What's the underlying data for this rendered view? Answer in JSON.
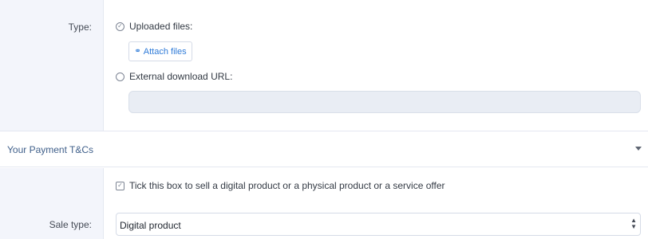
{
  "type_field": {
    "label": "Type:",
    "options": [
      {
        "label": "Uploaded files:",
        "icon": "check-circle-icon",
        "checked": true
      },
      {
        "label": "External download URL:",
        "icon": "radio-empty-icon",
        "checked": false
      }
    ],
    "attach_button": {
      "label": "Attach files",
      "icon": "paperclip-icon"
    },
    "url_input": {
      "value": "",
      "placeholder": ""
    }
  },
  "payment_section": {
    "title": "Your Payment T&Cs",
    "toggle_icon": "caret-down-icon"
  },
  "sale_field": {
    "checkbox_label": "Tick this box to sell a digital product or a physical product or a service offer",
    "checkbox_checked": true,
    "label": "Sale type:",
    "selected": "Digital product",
    "select_icon": "select-arrows-icon"
  },
  "colors": {
    "label_column_bg": "#f3f5fb",
    "link_blue": "#2f7bd8",
    "section_title": "#3f5f8a",
    "input_disabled_bg": "#e9edf4"
  }
}
